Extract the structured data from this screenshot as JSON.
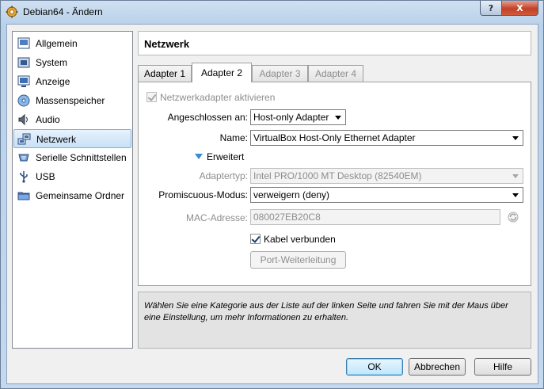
{
  "window": {
    "title": "Debian64 - Ändern",
    "help_label": "?",
    "close_label": "X"
  },
  "categories": [
    {
      "label": "Allgemein",
      "icon": "general-icon"
    },
    {
      "label": "System",
      "icon": "system-icon"
    },
    {
      "label": "Anzeige",
      "icon": "display-icon"
    },
    {
      "label": "Massenspeicher",
      "icon": "storage-icon"
    },
    {
      "label": "Audio",
      "icon": "audio-icon"
    },
    {
      "label": "Netzwerk",
      "icon": "network-icon",
      "selected": true
    },
    {
      "label": "Serielle Schnittstellen",
      "icon": "serial-port-icon"
    },
    {
      "label": "USB",
      "icon": "usb-icon"
    },
    {
      "label": "Gemeinsame Ordner",
      "icon": "shared-folder-icon"
    }
  ],
  "header": {
    "title": "Netzwerk"
  },
  "tabs": [
    {
      "label": "Adapter 1",
      "state": "normal"
    },
    {
      "label": "Adapter 2",
      "state": "active"
    },
    {
      "label": "Adapter 3",
      "state": "disabled"
    },
    {
      "label": "Adapter 4",
      "state": "disabled"
    }
  ],
  "adapter": {
    "enable_label": "Netzwerkadapter aktivieren",
    "enable_checked": true,
    "attached_label": "Angeschlossen an:",
    "attached_value": "Host-only Adapter",
    "name_label": "Name:",
    "name_value": "VirtualBox Host-Only Ethernet Adapter",
    "advanced_label": "Erweitert",
    "type_label": "Adaptertyp:",
    "type_value": "Intel PRO/1000 MT Desktop (82540EM)",
    "promisc_label": "Promiscuous-Modus:",
    "promisc_value": "verweigern (deny)",
    "mac_label": "MAC-Adresse:",
    "mac_value": "080027EB20C8",
    "cable_label": "Kabel verbunden",
    "cable_checked": true,
    "port_forwarding_label": "Port-Weiterleitung"
  },
  "info": {
    "text": "Wählen Sie eine Kategorie aus der Liste auf der linken Seite und fahren Sie mit der Maus über eine Einstellung, um mehr Informationen zu erhalten."
  },
  "buttons": {
    "ok": "OK",
    "cancel": "Abbrechen",
    "help": "Hilfe"
  },
  "colors": {
    "accent": "#3b8ad3",
    "selection": "#c9e0f7"
  }
}
